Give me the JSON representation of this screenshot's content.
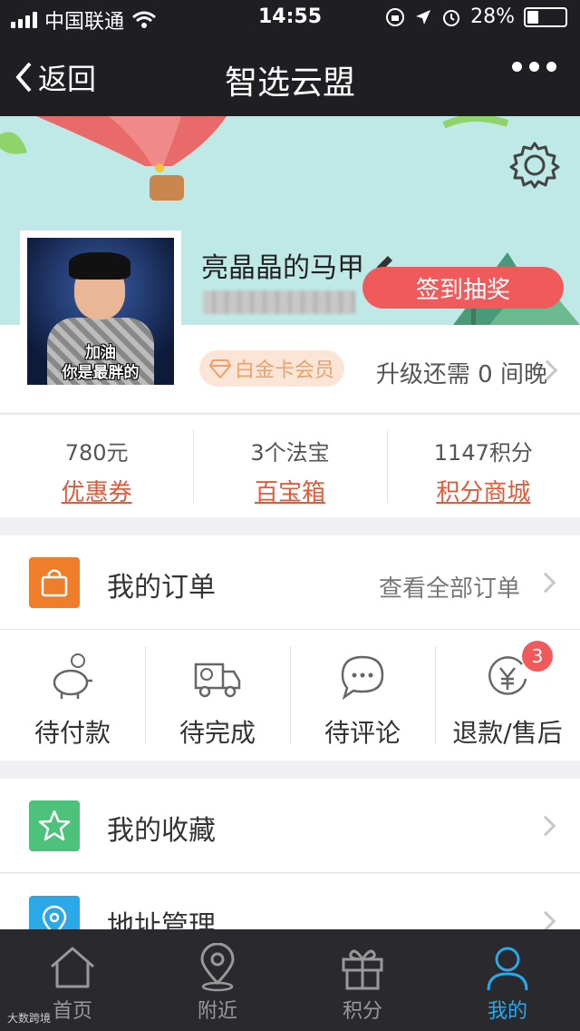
{
  "status_bar": {
    "carrier": "中国联通",
    "time": "14:55",
    "battery": "28%"
  },
  "navbar": {
    "back_label": "返回",
    "title": "智选云盟"
  },
  "profile": {
    "avatar_caption_line1": "加油",
    "avatar_caption_line2": "你是最胖的",
    "username": "亮晶晶的马甲",
    "signin_button": "签到抽奖",
    "member_badge": "白金卡会员",
    "upgrade_text": "升级还需 0 间晚"
  },
  "stats": [
    {
      "value": "780元",
      "label": "优惠券"
    },
    {
      "value": "3个法宝",
      "label": "百宝箱"
    },
    {
      "value": "1147积分",
      "label": "积分商城"
    }
  ],
  "orders": {
    "title": "我的订单",
    "view_all": "查看全部订单",
    "status_items": [
      {
        "label": "待付款",
        "icon": "piggy-bank-icon"
      },
      {
        "label": "待完成",
        "icon": "truck-icon"
      },
      {
        "label": "待评论",
        "icon": "chat-bubble-icon"
      },
      {
        "label": "退款/售后",
        "icon": "yen-refund-icon",
        "badge": "3"
      }
    ]
  },
  "menu": {
    "favorites": "我的收藏",
    "address": "地址管理"
  },
  "tabbar": [
    {
      "label": "首页",
      "icon": "home-icon"
    },
    {
      "label": "附近",
      "icon": "location-pin-icon"
    },
    {
      "label": "积分",
      "icon": "gift-icon"
    },
    {
      "label": "我的",
      "icon": "user-icon",
      "active": true
    }
  ],
  "colors": {
    "accent": "#2aa8e8",
    "signin": "#f05a5a",
    "orders_icon": "#f07d2a",
    "favorites_icon": "#4cc27b",
    "address_icon": "#2aa8e8"
  },
  "watermark": "大数跨境"
}
